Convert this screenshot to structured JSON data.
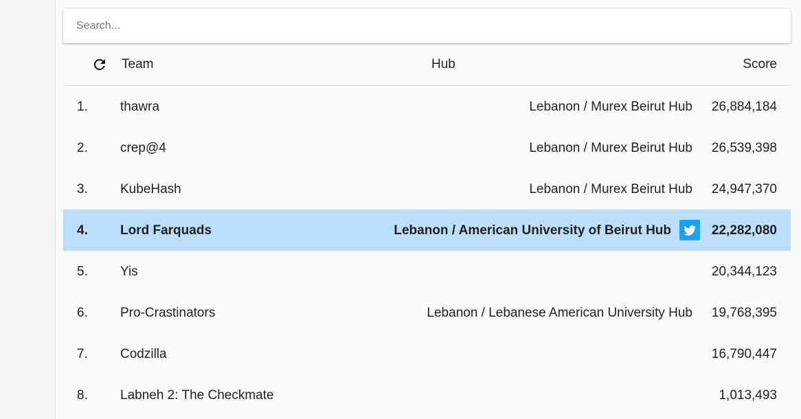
{
  "search": {
    "placeholder": "Search..."
  },
  "header": {
    "team": "Team",
    "hub": "Hub",
    "score": "Score"
  },
  "rows": [
    {
      "rank": "1.",
      "team": "thawra",
      "hub": "Lebanon / Murex Beirut Hub",
      "score": "26,884,184"
    },
    {
      "rank": "2.",
      "team": "crep@4",
      "hub": "Lebanon / Murex Beirut Hub",
      "score": "26,539,398"
    },
    {
      "rank": "3.",
      "team": "KubeHash",
      "hub": "Lebanon / Murex Beirut Hub",
      "score": "24,947,370"
    },
    {
      "rank": "4.",
      "team": "Lord Farquads",
      "hub": "Lebanon / American University of Beirut Hub",
      "score": "22,282,080"
    },
    {
      "rank": "5.",
      "team": "Yis",
      "hub": "",
      "score": "20,344,123"
    },
    {
      "rank": "6.",
      "team": "Pro-Crastinators",
      "hub": "Lebanon / Lebanese American University Hub",
      "score": "19,768,395"
    },
    {
      "rank": "7.",
      "team": "Codzilla",
      "hub": "",
      "score": "16,790,447"
    },
    {
      "rank": "8.",
      "team": "Labneh 2: The Checkmate",
      "hub": "",
      "score": "1,013,493"
    }
  ],
  "icons": {
    "refresh": "refresh-icon",
    "twitter": "twitter-icon"
  },
  "colors": {
    "highlight_row": "#bbdefb",
    "twitter_blue": "#1da1f2"
  }
}
